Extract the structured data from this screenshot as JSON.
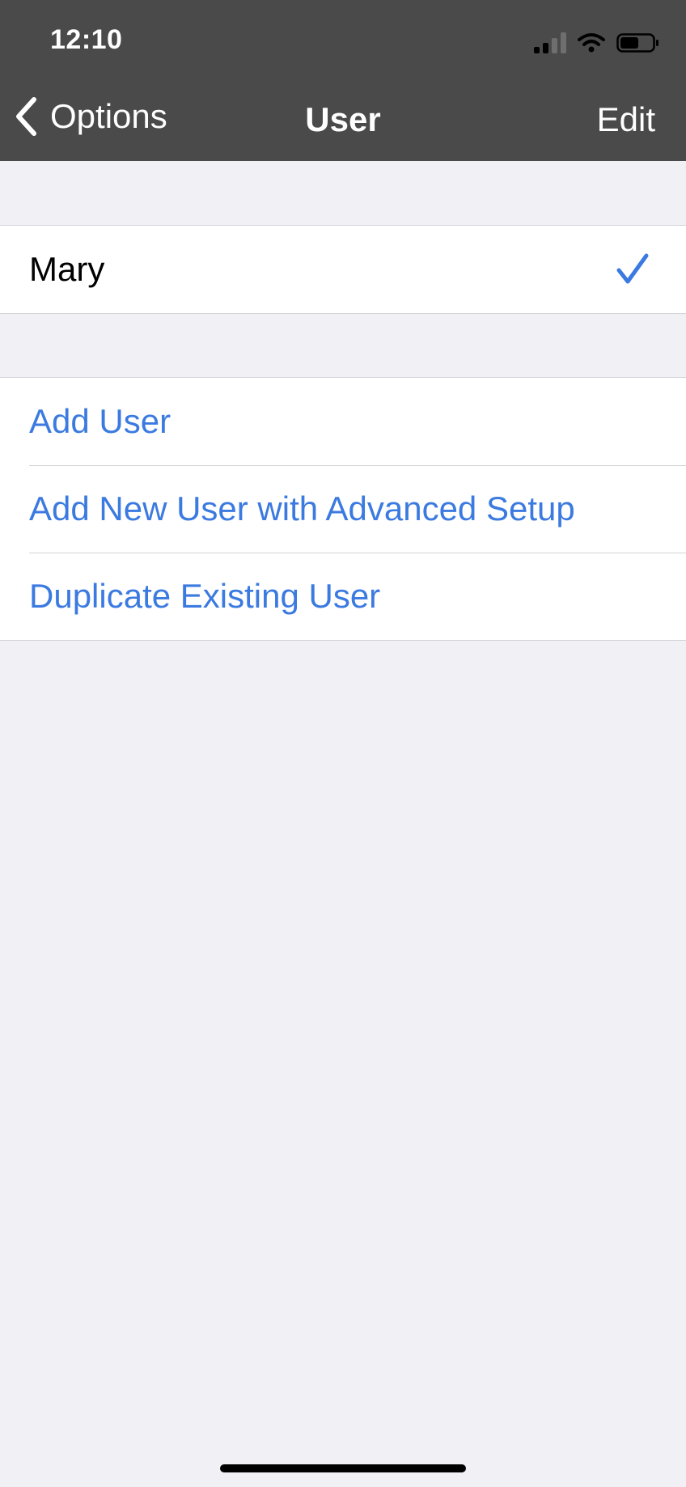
{
  "status_bar": {
    "time": "12:10",
    "icons": [
      "cellular-signal-icon",
      "wifi-icon",
      "battery-icon"
    ]
  },
  "nav": {
    "back_label": "Options",
    "title": "User",
    "edit_label": "Edit"
  },
  "users": [
    {
      "name": "Mary",
      "selected": true
    }
  ],
  "actions": [
    {
      "label": "Add User"
    },
    {
      "label": "Add New User with Advanced Setup"
    },
    {
      "label": "Duplicate Existing User"
    }
  ],
  "colors": {
    "nav_bar": "#4a4a4a",
    "background": "#f0f0f5",
    "accent": "#3b7ae0",
    "separator": "#d3d3d8"
  }
}
